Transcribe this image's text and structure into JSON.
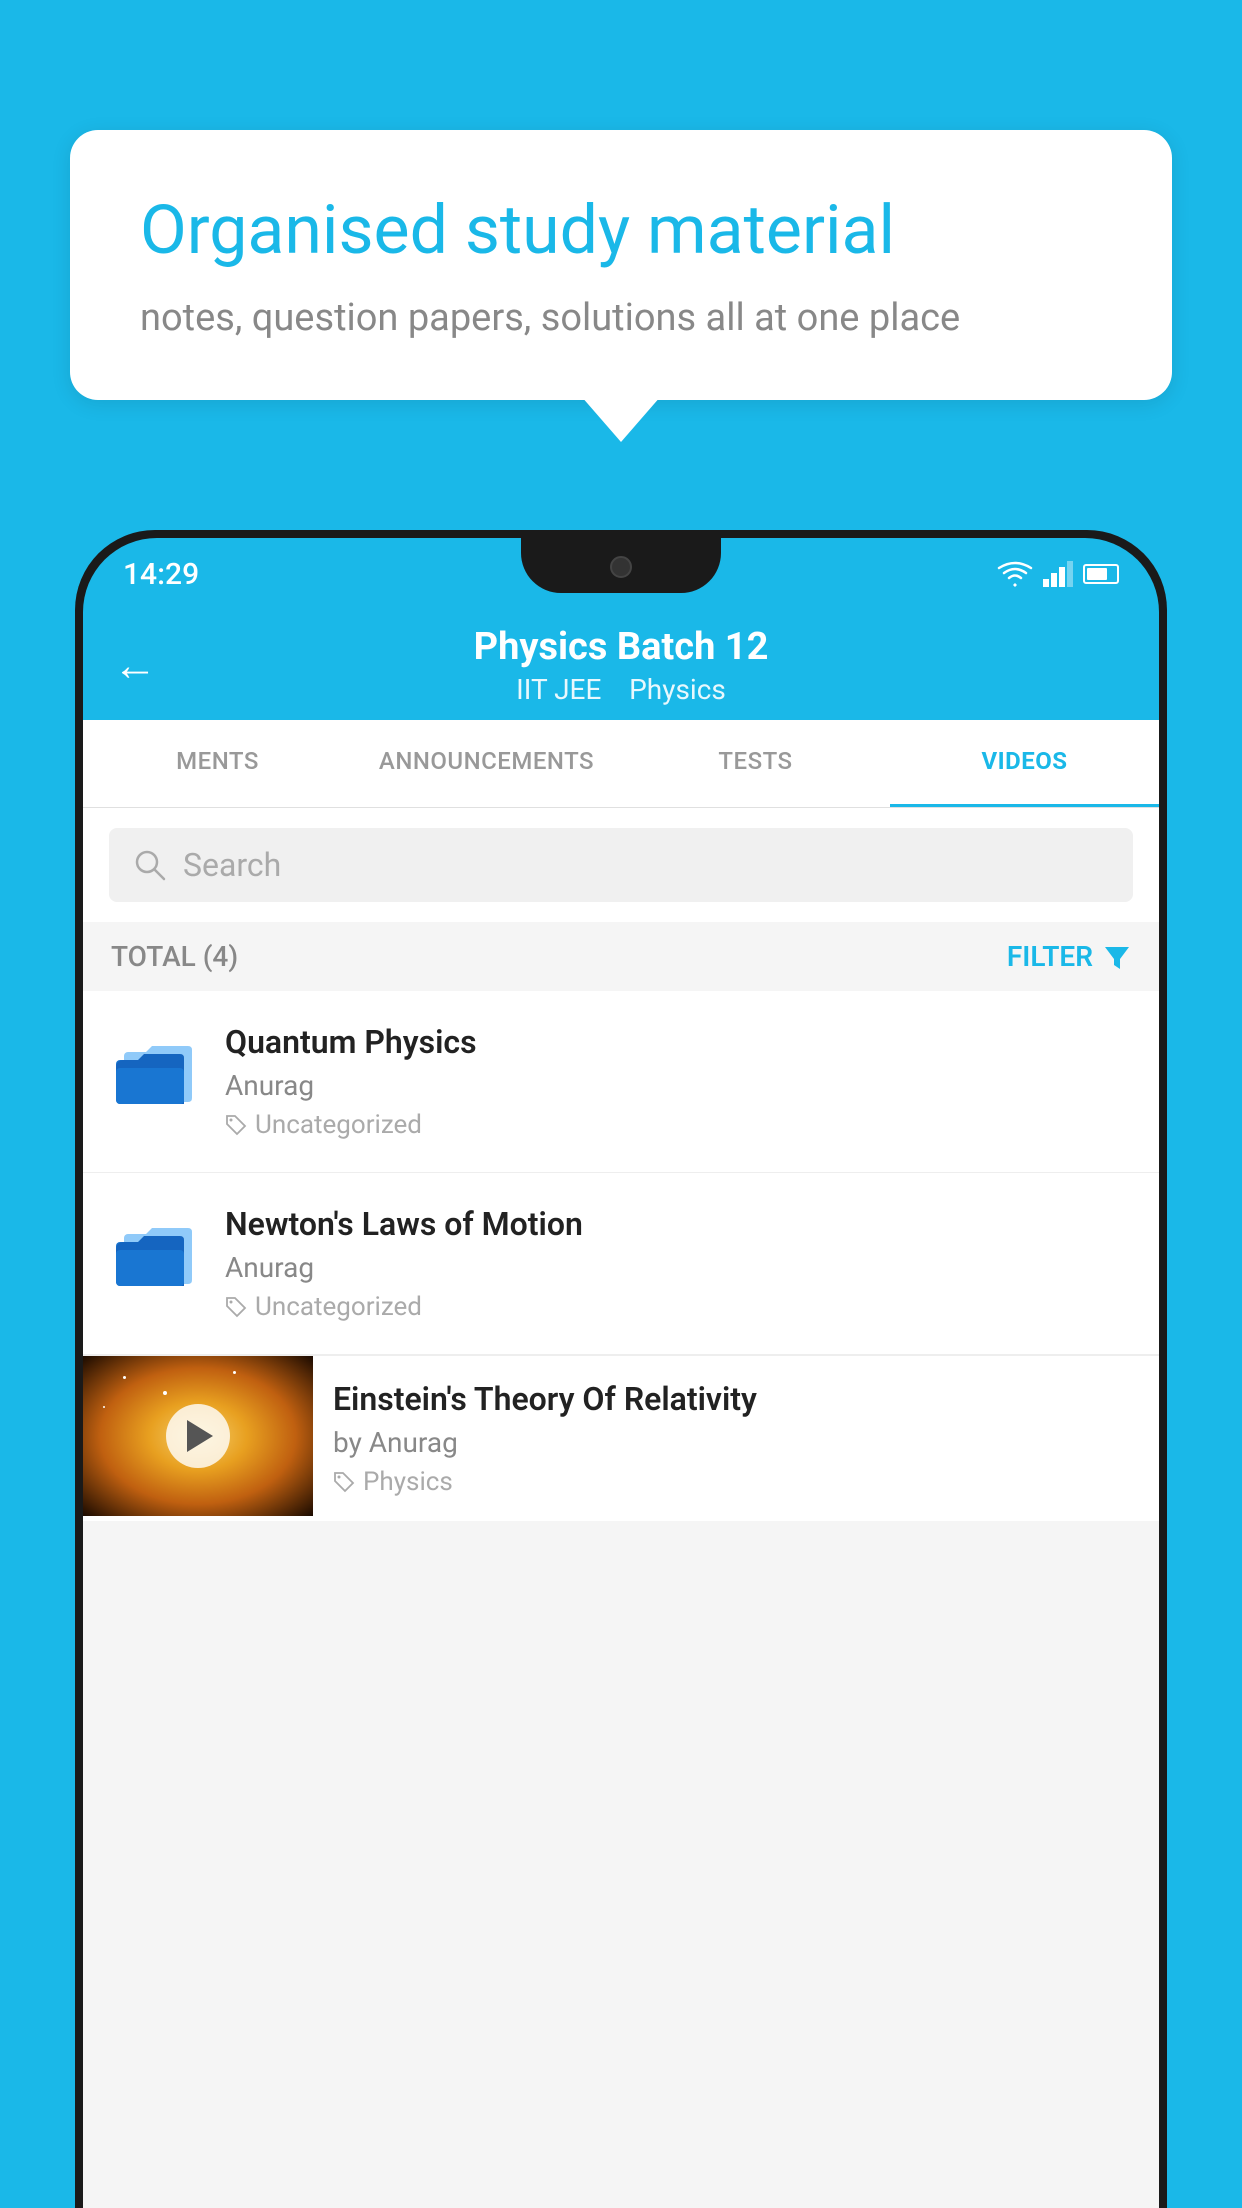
{
  "bubble": {
    "title": "Organised study material",
    "subtitle": "notes, question papers, solutions all at one place"
  },
  "status_bar": {
    "time": "14:29",
    "icons": [
      "wifi",
      "signal",
      "battery"
    ]
  },
  "header": {
    "back_label": "←",
    "title": "Physics Batch 12",
    "subtitle_tag1": "IIT JEE",
    "subtitle_tag2": "Physics"
  },
  "tabs": [
    {
      "label": "MENTS",
      "active": false
    },
    {
      "label": "ANNOUNCEMENTS",
      "active": false
    },
    {
      "label": "TESTS",
      "active": false
    },
    {
      "label": "VIDEOS",
      "active": true
    }
  ],
  "search": {
    "placeholder": "Search"
  },
  "filter_row": {
    "total_label": "TOTAL (4)",
    "filter_label": "FILTER"
  },
  "videos": [
    {
      "title": "Quantum Physics",
      "author": "Anurag",
      "tag": "Uncategorized",
      "has_thumb": false
    },
    {
      "title": "Newton's Laws of Motion",
      "author": "Anurag",
      "tag": "Uncategorized",
      "has_thumb": false
    },
    {
      "title": "Einstein's Theory Of Relativity",
      "author": "by Anurag",
      "tag": "Physics",
      "has_thumb": true
    }
  ],
  "colors": {
    "primary": "#1ab8e8",
    "text_dark": "#222222",
    "text_grey": "#888888",
    "text_light": "#aaaaaa"
  }
}
